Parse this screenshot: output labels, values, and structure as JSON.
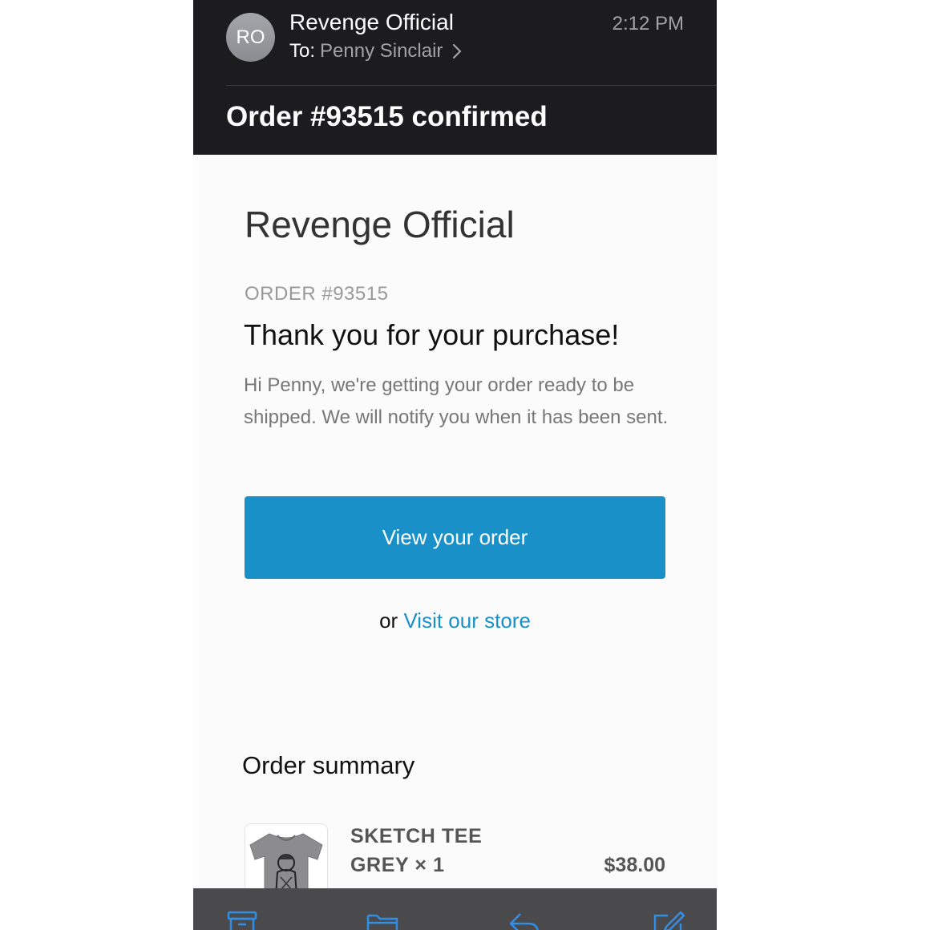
{
  "header": {
    "avatar_initials": "RO",
    "sender": "Revenge Official",
    "to_label": "To:",
    "recipient": "Penny Sinclair",
    "time": "2:12 PM",
    "subject": "Order #93515 confirmed"
  },
  "email": {
    "shop_name": "Revenge Official",
    "order_number": "ORDER #93515",
    "heading": "Thank you for your purchase!",
    "intro": "Hi Penny, we're getting your order ready to be shipped. We will notify you when it has been sent.",
    "button_label": "View your order",
    "or_text": "or",
    "store_link": "Visit our store",
    "summary_heading": "Order summary",
    "item": {
      "name": "SKETCH TEE",
      "variant": "GREY × 1",
      "price": "$38.00"
    }
  },
  "toolbar": {
    "icons": [
      "archive-icon",
      "folder-icon",
      "reply-icon",
      "compose-icon"
    ]
  },
  "colors": {
    "header_bg": "#1c1c1e",
    "accent": "#1a90c8",
    "toolbar_bg": "#4a4a4d"
  }
}
